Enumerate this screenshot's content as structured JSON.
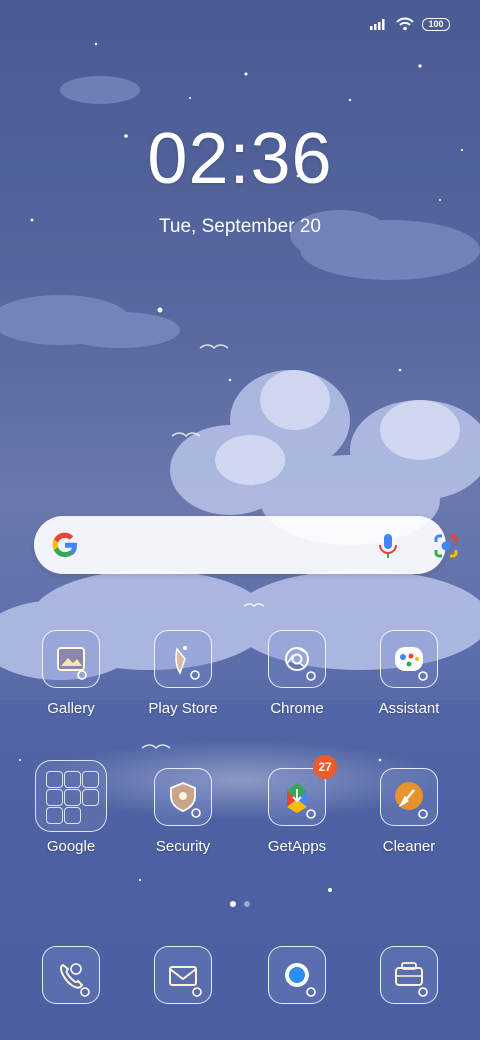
{
  "status_bar": {
    "battery": "100",
    "icons": [
      "signal-icon",
      "wifi-icon",
      "battery-icon"
    ]
  },
  "lockscreen": {
    "time": "02:36",
    "date": "Tue, September 20"
  },
  "search": {
    "icons": [
      "google-logo-icon",
      "mic-icon",
      "lens-icon"
    ]
  },
  "apps_row1": [
    {
      "label": "Gallery",
      "icon": "gallery-icon"
    },
    {
      "label": "Play Store",
      "icon": "play-store-icon"
    },
    {
      "label": "Chrome",
      "icon": "chrome-icon"
    },
    {
      "label": "Assistant",
      "icon": "assistant-icon"
    }
  ],
  "apps_row2": [
    {
      "label": "Google",
      "icon": "folder-icon"
    },
    {
      "label": "Security",
      "icon": "security-icon"
    },
    {
      "label": "GetApps",
      "icon": "getapps-icon",
      "badge": "27"
    },
    {
      "label": "Cleaner",
      "icon": "cleaner-icon"
    }
  ],
  "dock": [
    {
      "icon": "phone-icon"
    },
    {
      "icon": "messages-icon"
    },
    {
      "icon": "browser-icon"
    },
    {
      "icon": "camera-icon"
    }
  ],
  "page_indicator": {
    "pages": 2,
    "active": 1
  },
  "colors": {
    "accent_badge": "#f05a28",
    "mic_blue": "#4285f4"
  }
}
